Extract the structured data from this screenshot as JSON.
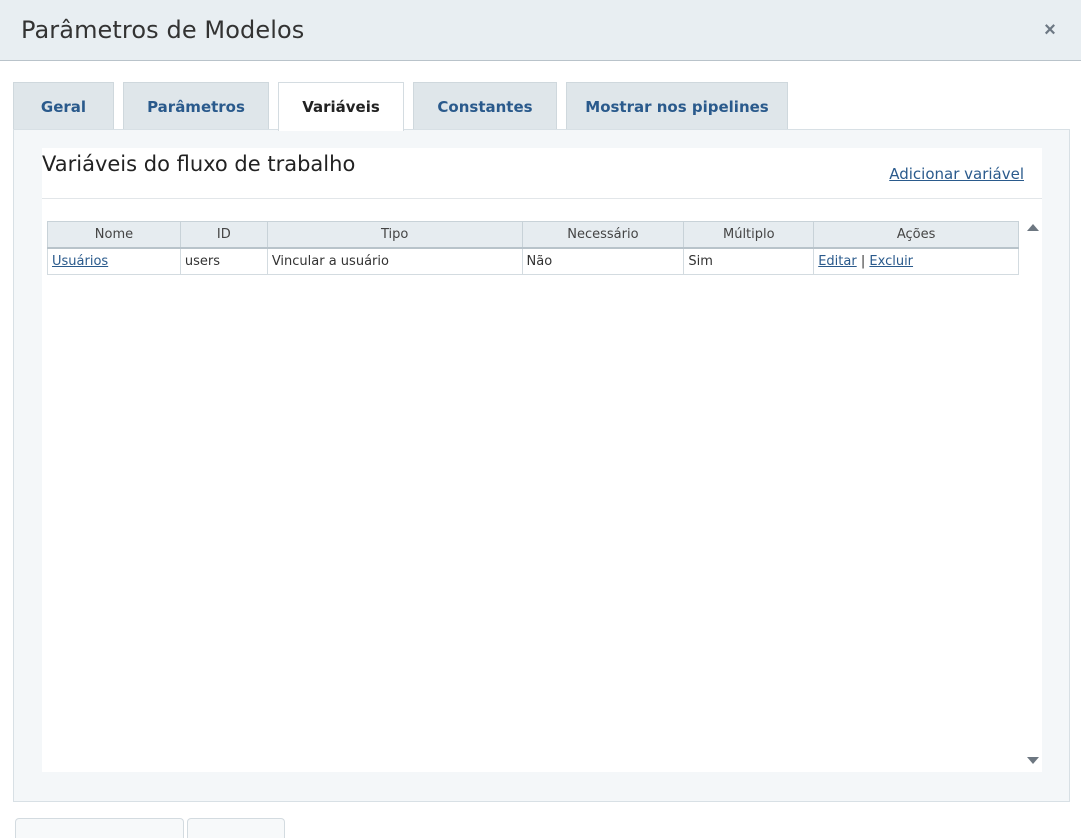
{
  "dialog": {
    "title": "Parâmetros de Modelos",
    "close_label": "×"
  },
  "tabs": [
    {
      "label": "Geral",
      "active": false
    },
    {
      "label": "Parâmetros",
      "active": false
    },
    {
      "label": "Variáveis",
      "active": true
    },
    {
      "label": "Constantes",
      "active": false
    },
    {
      "label": "Mostrar nos pipelines",
      "active": false
    }
  ],
  "section": {
    "title": "Variáveis do fluxo de trabalho",
    "add_link": "Adicionar variável"
  },
  "table": {
    "columns": [
      "Nome",
      "ID",
      "Tipo",
      "Necessário",
      "Múltiplo",
      "Ações"
    ],
    "rows": [
      {
        "nome": "Usuários",
        "id": "users",
        "tipo": "Vincular a usuário",
        "necessario": "Não",
        "multiplo": "Sim",
        "editar": "Editar",
        "separator": "|",
        "excluir": "Excluir"
      }
    ]
  },
  "colors": {
    "header_bg": "#e8eef2",
    "tab_bg": "#dfe6ea",
    "link": "#2a5a8c"
  }
}
